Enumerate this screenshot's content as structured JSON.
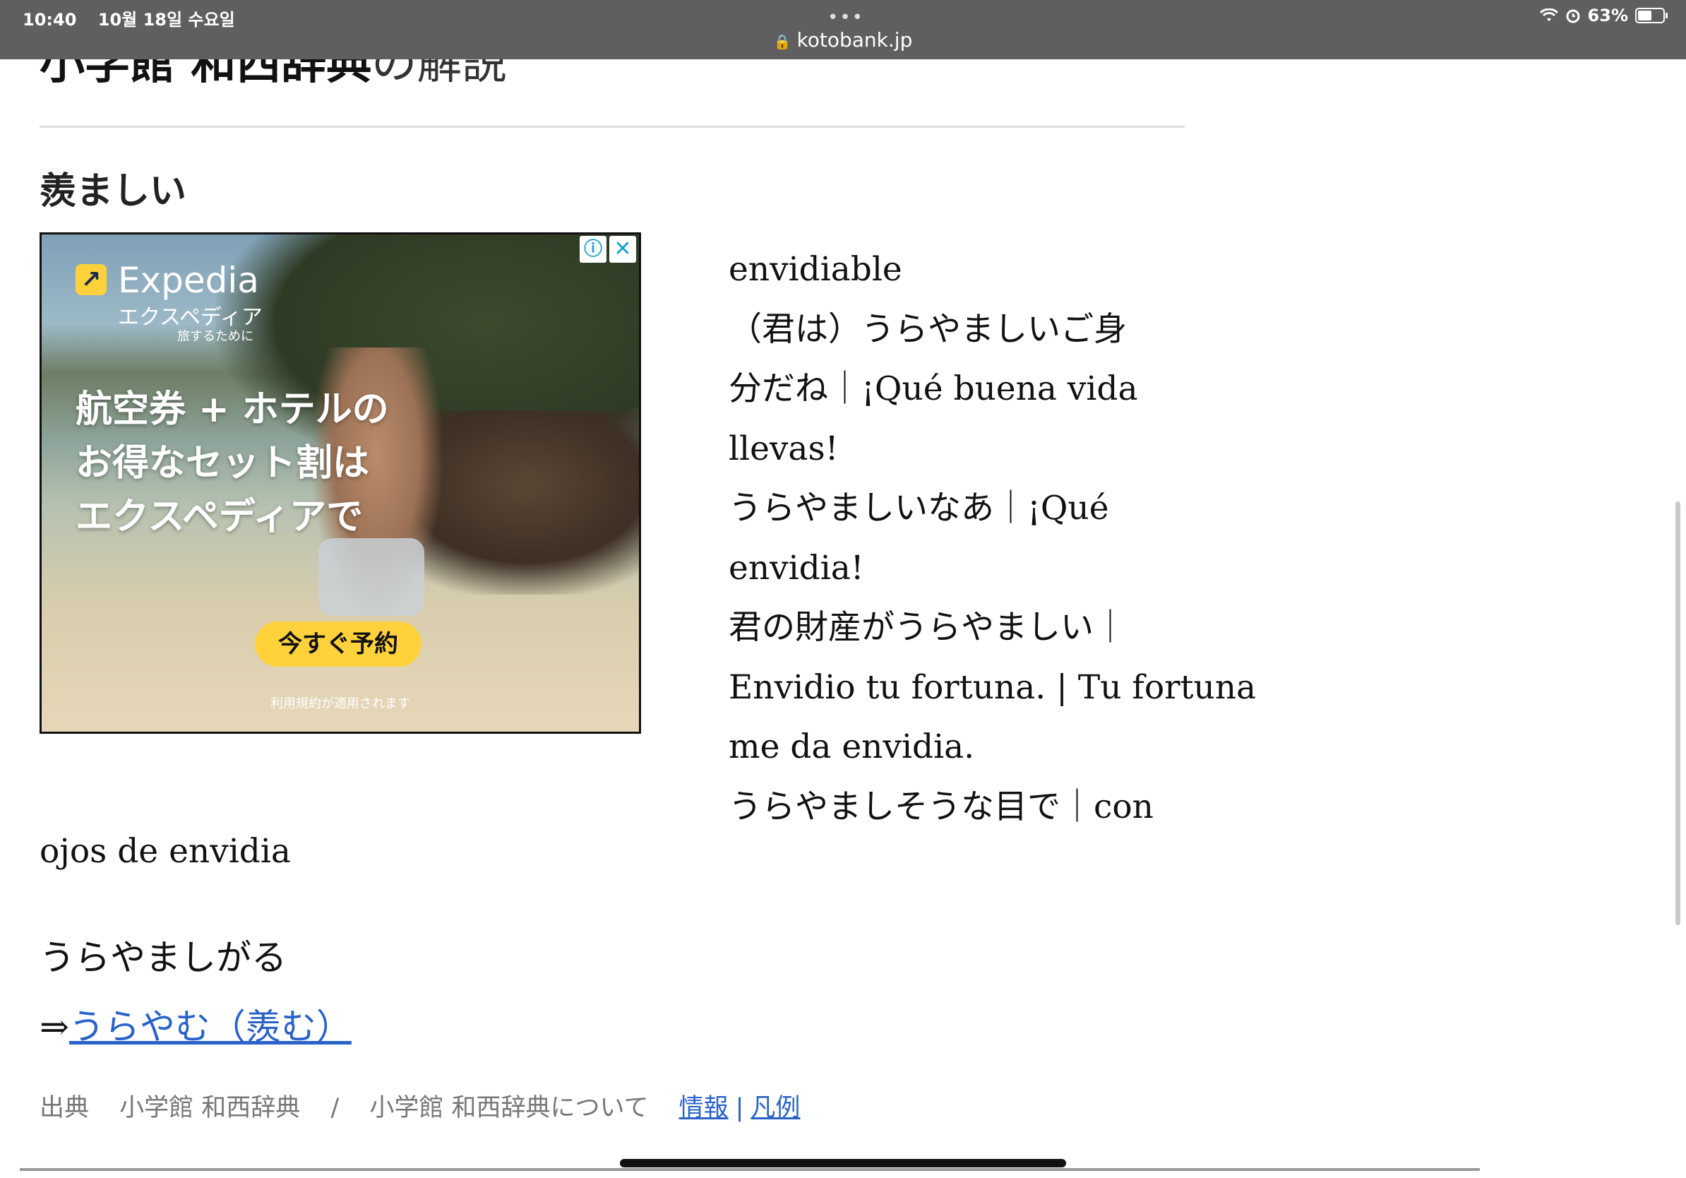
{
  "status": {
    "time": "10:40",
    "date": "10월 18일 수요일",
    "battery": "63%",
    "battery_fraction": 0.63,
    "wifi_icon": "wifi-icon",
    "alarm_icon": "alarm-icon"
  },
  "browser": {
    "url": "kotobank.jp",
    "menu_dots": "•••"
  },
  "section": {
    "title_bold": "小学館 和西辞典",
    "title_light": "の解説"
  },
  "entry": {
    "headword": "羨ましい",
    "lines": [
      "envidiable",
      "（君は）うらやましいご身",
      "分だね｜¡Qué buena vida",
      "llevas!",
      "うらやましいなあ｜¡Qué",
      "envidia!",
      "君の財産がうらやましい｜",
      "Envidio tu fortuna. | Tu fortuna",
      "me da envidia.",
      "うらやましそうな目で｜con"
    ],
    "continuation": "ojos de envidia",
    "derivative": "うらやましがる",
    "xref_arrow": "⇒",
    "xref_link": "うらやむ（羨む）"
  },
  "ad": {
    "brand": "Expedia",
    "brand_kana": "エクスペディア",
    "tagline": "旅するために",
    "copy": [
      "航空券 + ホテルの",
      "お得なセット割は",
      "エクスペディアで"
    ],
    "cta": "今すぐ予約",
    "terms": "利用規約が適用されます",
    "info": "ⓘ",
    "close": "✕"
  },
  "source": {
    "label": "出典",
    "dictionary": "小学館 和西辞典",
    "slash": "/",
    "about": "小学館 和西辞典について",
    "info_link": "情報",
    "separator": "|",
    "legend_link": "凡例"
  }
}
